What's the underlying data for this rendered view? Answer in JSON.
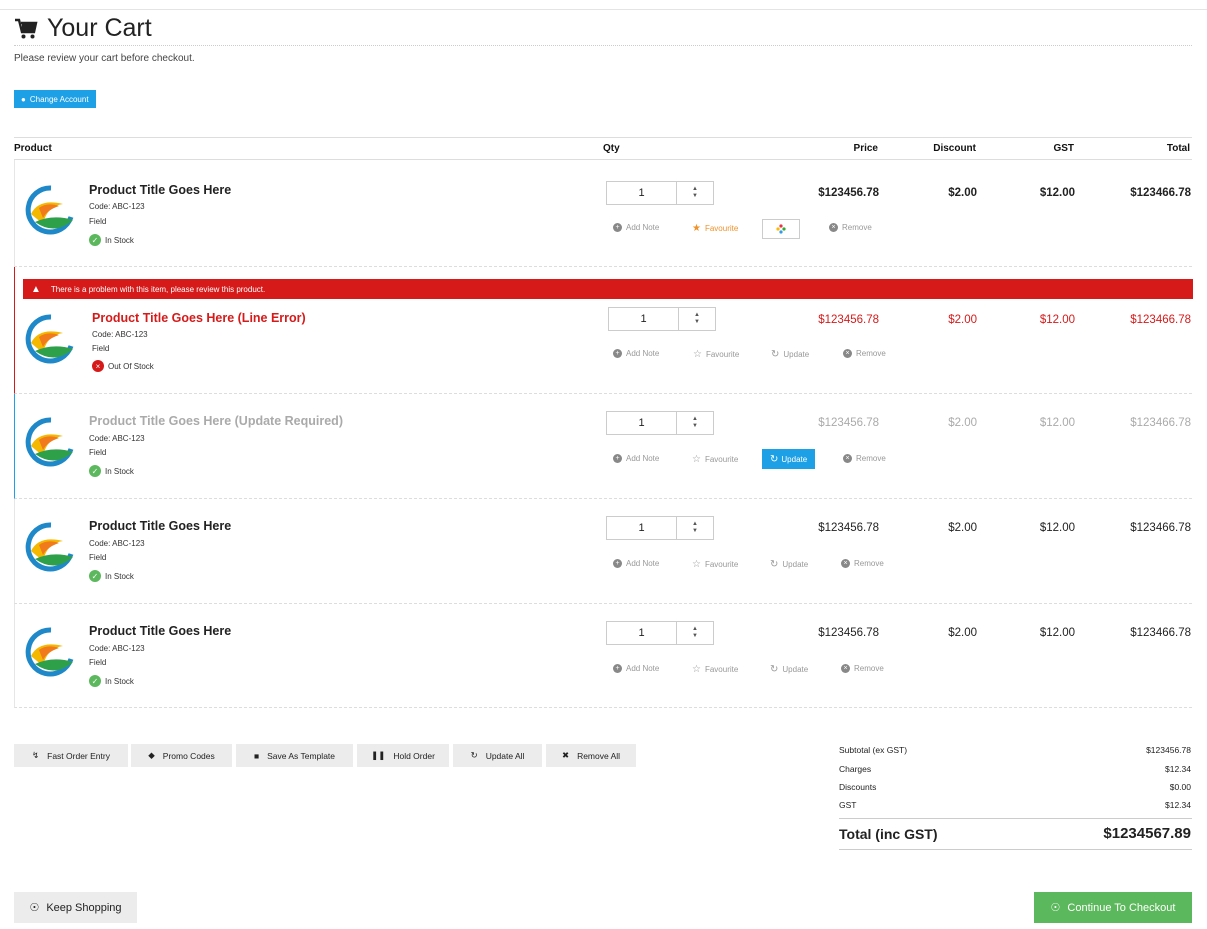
{
  "page": {
    "title": "Your Cart",
    "subtitle": "Please review your cart before checkout.",
    "change_account": "Change Account"
  },
  "table_headers": {
    "product": "Product",
    "qty": "Qty",
    "price": "Price",
    "discount": "Discount",
    "gst": "GST",
    "total": "Total"
  },
  "actions": {
    "add_note": "Add Note",
    "favourite": "Favourite",
    "update": "Update",
    "remove": "Remove"
  },
  "error_message": "There is a problem with this item, please review this product.",
  "items": [
    {
      "title": "Product Title Goes Here",
      "code": "Code: ABC-123",
      "field": "Field",
      "stock": "In Stock",
      "qty": "1",
      "price": "$123456.78",
      "discount": "$2.00",
      "gst": "$12.00",
      "total": "$123466.78"
    },
    {
      "title": "Product Title Goes Here (Line Error)",
      "code": "Code: ABC-123",
      "field": "Field",
      "stock": "Out Of Stock",
      "qty": "1",
      "price": "$123456.78",
      "discount": "$2.00",
      "gst": "$12.00",
      "total": "$123466.78"
    },
    {
      "title": "Product Title Goes Here (Update Required)",
      "code": "Code: ABC-123",
      "field": "Field",
      "stock": "In Stock",
      "qty": "1",
      "price": "$123456.78",
      "discount": "$2.00",
      "gst": "$12.00",
      "total": "$123466.78"
    },
    {
      "title": "Product Title Goes Here",
      "code": "Code: ABC-123",
      "field": "Field",
      "stock": "In Stock",
      "qty": "1",
      "price": "$123456.78",
      "discount": "$2.00",
      "gst": "$12.00",
      "total": "$123466.78"
    },
    {
      "title": "Product Title Goes Here",
      "code": "Code: ABC-123",
      "field": "Field",
      "stock": "In Stock",
      "qty": "1",
      "price": "$123456.78",
      "discount": "$2.00",
      "gst": "$12.00",
      "total": "$123466.78"
    }
  ],
  "toolbar": {
    "fast_order": "Fast Order Entry",
    "promo_codes": "Promo Codes",
    "save_template": "Save As Template",
    "hold_order": "Hold Order",
    "update_all": "Update All",
    "remove_all": "Remove All"
  },
  "summary": {
    "subtotal_label": "Subtotal (ex GST)",
    "subtotal": "$123456.78",
    "charges_label": "Charges",
    "charges": "$12.34",
    "discounts_label": "Discounts",
    "discounts": "$0.00",
    "gst_label": "GST",
    "gst": "$12.34",
    "total_label": "Total (inc GST)",
    "total": "$1234567.89"
  },
  "footer": {
    "keep_shopping": "Keep Shopping",
    "continue_checkout": "Continue To Checkout"
  },
  "colors": {
    "accent": "#1ea0e6",
    "error": "#d61a1a",
    "success": "#5cb85c",
    "favourite": "#f0922b"
  }
}
